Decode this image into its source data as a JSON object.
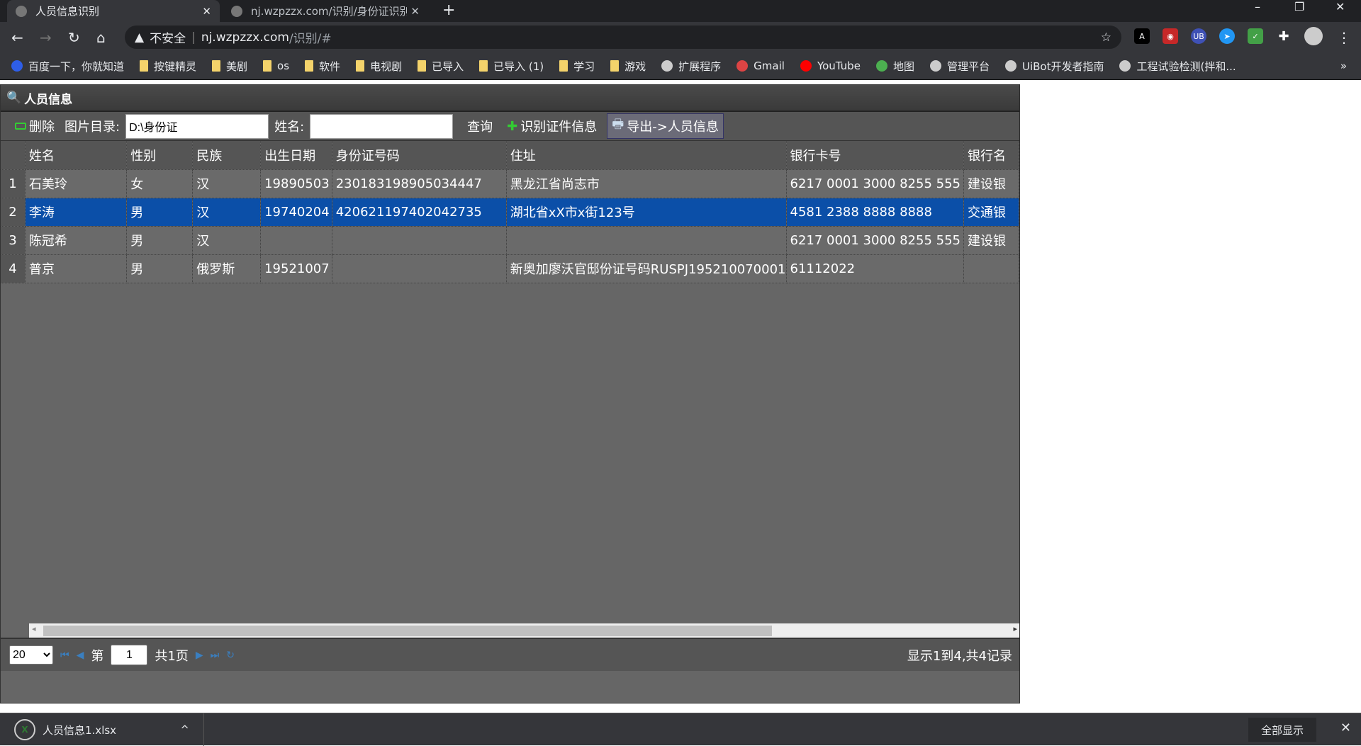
{
  "browser": {
    "tabs": [
      {
        "title": "人员信息识别",
        "active": true
      },
      {
        "title": "nj.wzpzzx.com/识别/身份证识别",
        "active": false
      }
    ],
    "security_label": "不安全",
    "url_host": "nj.wzpzzx.com",
    "url_path": "/识别/#",
    "bookmarks": [
      {
        "label": "百度一下，你就知道",
        "icon": "baidu-icon"
      },
      {
        "label": "按键精灵",
        "icon": "folder-icon"
      },
      {
        "label": "美剧",
        "icon": "folder-icon"
      },
      {
        "label": "os",
        "icon": "folder-icon"
      },
      {
        "label": "软件",
        "icon": "folder-icon"
      },
      {
        "label": "电视剧",
        "icon": "folder-icon"
      },
      {
        "label": "已导入",
        "icon": "folder-icon"
      },
      {
        "label": "已导入 (1)",
        "icon": "folder-icon"
      },
      {
        "label": "学习",
        "icon": "folder-icon"
      },
      {
        "label": "游戏",
        "icon": "folder-icon"
      },
      {
        "label": "扩展程序",
        "icon": "puzzle-icon"
      },
      {
        "label": "Gmail",
        "icon": "gmail-icon"
      },
      {
        "label": "YouTube",
        "icon": "youtube-icon"
      },
      {
        "label": "地图",
        "icon": "maps-icon"
      },
      {
        "label": "管理平台",
        "icon": "globe-icon"
      },
      {
        "label": "UiBot开发者指南",
        "icon": "globe-icon"
      },
      {
        "label": "工程试验检测(拌和...",
        "icon": "globe-icon"
      }
    ],
    "bookmarks_more": "»"
  },
  "panel": {
    "title": "人员信息",
    "toolbar": {
      "delete_label": "删除",
      "dir_label": "图片目录:",
      "dir_value": "D:\\身份证",
      "name_label": "姓名:",
      "name_value": "",
      "query_label": "查询",
      "recognize_label": "识别证件信息",
      "export_label": "导出->人员信息"
    },
    "columns": [
      "姓名",
      "性别",
      "民族",
      "出生日期",
      "身份证号码",
      "住址",
      "银行卡号",
      "银行名"
    ],
    "rows": [
      {
        "n": "1",
        "cells": [
          "石美玲",
          "女",
          "汉",
          "19890503",
          "230183198905034447",
          "黑龙江省尚志市",
          "6217 0001 3000 8255 555",
          "建设银"
        ]
      },
      {
        "n": "2",
        "cells": [
          "李涛",
          "男",
          "汉",
          "19740204",
          "420621197402042735",
          "湖北省xX市x街123号",
          "4581 2388 8888 8888",
          "交通银"
        ],
        "selected": true
      },
      {
        "n": "3",
        "cells": [
          "陈冠希",
          "男",
          "汉",
          "",
          "",
          "",
          "6217 0001 3000 8255 555",
          "建设银"
        ]
      },
      {
        "n": "4",
        "cells": [
          "普京",
          "男",
          "俄罗斯",
          "19521007",
          "",
          "新奥加廖沃官邸份证号码RUSPJ195210070001",
          "61112022",
          ""
        ]
      }
    ],
    "pager": {
      "page_size": "20",
      "page_prefix": "第",
      "page_value": "1",
      "page_suffix": "共1页",
      "info": "显示1到4,共4记录"
    }
  },
  "download": {
    "filename": "人员信息1.xlsx",
    "show_all": "全部显示"
  }
}
